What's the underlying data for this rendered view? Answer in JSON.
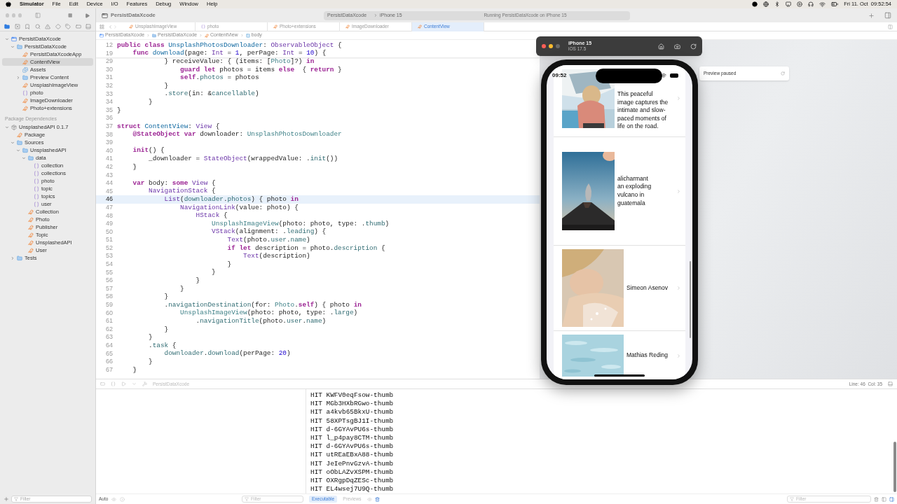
{
  "menubar": {
    "app_name": "Simulator",
    "menus": [
      "File",
      "Edit",
      "Device",
      "I/O",
      "Features",
      "Debug",
      "Window",
      "Help"
    ],
    "clock": "Fri 11. Oct  09:52:54"
  },
  "toolbar": {
    "project": "PersistDataXcode",
    "scheme": "PersistDataXcode",
    "destination": "iPhone 15",
    "status": "Running PersistDataXcode on iPhone 15"
  },
  "tabs": [
    {
      "label": "UnsplashImageView",
      "kind": "swift",
      "selected": false
    },
    {
      "label": "photo",
      "kind": "json",
      "selected": false
    },
    {
      "label": "Photo+extensions",
      "kind": "swift",
      "selected": false
    },
    {
      "label": "ImageDownloader",
      "kind": "swift",
      "selected": false
    },
    {
      "label": "ContentView",
      "kind": "swift",
      "selected": true
    }
  ],
  "jump_bar": [
    {
      "label": "PersistDataXcode",
      "kind": "project"
    },
    {
      "label": "PersistDataXcode",
      "kind": "folder"
    },
    {
      "label": "ContentView",
      "kind": "swift"
    },
    {
      "label": "body",
      "kind": "property"
    }
  ],
  "navigator": {
    "tree": [
      {
        "label": "PersistDataXcode",
        "kind": "project",
        "expanded": true,
        "selected": false,
        "children": [
          {
            "label": "PersistDataXcode",
            "kind": "folder",
            "expanded": true,
            "selected": false,
            "children": [
              {
                "label": "PersistDataXcodeApp",
                "kind": "swift",
                "selected": false
              },
              {
                "label": "ContentView",
                "kind": "swift",
                "selected": true
              },
              {
                "label": "Assets",
                "kind": "assets",
                "selected": false
              },
              {
                "label": "Preview Content",
                "kind": "folder",
                "expanded": false,
                "selected": false
              },
              {
                "label": "UnsplashImageView",
                "kind": "swift",
                "selected": false
              },
              {
                "label": "photo",
                "kind": "json",
                "selected": false
              },
              {
                "label": "ImageDownloader",
                "kind": "swift",
                "selected": false
              },
              {
                "label": "Photo+extensions",
                "kind": "swift",
                "selected": false
              }
            ]
          }
        ]
      }
    ],
    "section_title": "Package Dependencies",
    "packages": [
      {
        "label": "UnsplashedAPI 0.1.7",
        "kind": "package",
        "expanded": true,
        "selected": false,
        "children": [
          {
            "label": "Package",
            "kind": "swift",
            "selected": false
          },
          {
            "label": "Sources",
            "kind": "folder",
            "expanded": true,
            "selected": false,
            "children": [
              {
                "label": "UnsplashedAPI",
                "kind": "folder",
                "expanded": true,
                "selected": false,
                "children": [
                  {
                    "label": "data",
                    "kind": "folder",
                    "expanded": true,
                    "selected": false,
                    "children": [
                      {
                        "label": "collection",
                        "kind": "json",
                        "selected": false
                      },
                      {
                        "label": "collections",
                        "kind": "json",
                        "selected": false
                      },
                      {
                        "label": "photo",
                        "kind": "json",
                        "selected": false
                      },
                      {
                        "label": "topic",
                        "kind": "json",
                        "selected": false
                      },
                      {
                        "label": "topics",
                        "kind": "json",
                        "selected": false
                      },
                      {
                        "label": "user",
                        "kind": "json",
                        "selected": false
                      }
                    ]
                  },
                  {
                    "label": "Collection",
                    "kind": "swift",
                    "selected": false
                  },
                  {
                    "label": "Photo",
                    "kind": "swift",
                    "selected": false
                  },
                  {
                    "label": "Publisher",
                    "kind": "swift",
                    "selected": false
                  },
                  {
                    "label": "Topic",
                    "kind": "swift",
                    "selected": false
                  },
                  {
                    "label": "UnsplashedAPI",
                    "kind": "swift",
                    "selected": false
                  },
                  {
                    "label": "User",
                    "kind": "swift",
                    "selected": false
                  }
                ]
              }
            ]
          },
          {
            "label": "Tests",
            "kind": "folder",
            "expanded": false,
            "selected": false
          }
        ]
      }
    ],
    "filter_placeholder": "Filter"
  },
  "editor": {
    "sticky_lines": [
      {
        "number": "12",
        "segments": [
          {
            "kind": "kw",
            "text": "public class "
          },
          {
            "kind": "decl",
            "text": "UnsplashPhotosDownloader"
          },
          {
            "kind": "plain",
            "text": ": "
          },
          {
            "kind": "type",
            "text": "ObservableObject"
          },
          {
            "kind": "plain",
            "text": " {"
          }
        ]
      },
      {
        "number": "19",
        "segments": [
          {
            "kind": "kw",
            "text": "    func "
          },
          {
            "kind": "decl",
            "text": "download"
          },
          {
            "kind": "plain",
            "text": "(page: "
          },
          {
            "kind": "type",
            "text": "Int"
          },
          {
            "kind": "plain",
            "text": " = "
          },
          {
            "kind": "num",
            "text": "1"
          },
          {
            "kind": "plain",
            "text": ", perPage: "
          },
          {
            "kind": "type",
            "text": "Int"
          },
          {
            "kind": "plain",
            "text": " = "
          },
          {
            "kind": "num",
            "text": "10"
          },
          {
            "kind": "plain",
            "text": ") {"
          }
        ]
      }
    ],
    "lines": [
      {
        "number": "29",
        "current": false,
        "segments": [
          {
            "kind": "plain",
            "text": "            } receiveValue: { (items: ["
          },
          {
            "kind": "ptype",
            "text": "Photo"
          },
          {
            "kind": "plain",
            "text": "]?) "
          },
          {
            "kind": "kw",
            "text": "in"
          }
        ]
      },
      {
        "number": "30",
        "current": false,
        "segments": [
          {
            "kind": "kw",
            "text": "                guard let "
          },
          {
            "kind": "plain",
            "text": "photos = items "
          },
          {
            "kind": "kw",
            "text": "else"
          },
          {
            "kind": "plain",
            "text": "  { "
          },
          {
            "kind": "kw",
            "text": "return"
          },
          {
            "kind": "plain",
            "text": " }"
          }
        ]
      },
      {
        "number": "31",
        "current": false,
        "segments": [
          {
            "kind": "kw",
            "text": "                self"
          },
          {
            "kind": "plain",
            "text": "."
          },
          {
            "kind": "prop",
            "text": "photos"
          },
          {
            "kind": "plain",
            "text": " = photos"
          }
        ]
      },
      {
        "number": "32",
        "current": false,
        "segments": [
          {
            "kind": "plain",
            "text": "            }"
          }
        ]
      },
      {
        "number": "33",
        "current": false,
        "segments": [
          {
            "kind": "plain",
            "text": "            ."
          },
          {
            "kind": "fn",
            "text": "store"
          },
          {
            "kind": "plain",
            "text": "(in: &"
          },
          {
            "kind": "prop",
            "text": "cancellable"
          },
          {
            "kind": "plain",
            "text": ")"
          }
        ]
      },
      {
        "number": "34",
        "current": false,
        "segments": [
          {
            "kind": "plain",
            "text": "        }"
          }
        ]
      },
      {
        "number": "35",
        "current": false,
        "segments": [
          {
            "kind": "plain",
            "text": "}"
          }
        ]
      },
      {
        "number": "36",
        "current": false
      },
      {
        "number": "37",
        "current": false,
        "segments": [
          {
            "kind": "kw",
            "text": "struct "
          },
          {
            "kind": "decl",
            "text": "ContentView"
          },
          {
            "kind": "plain",
            "text": ": "
          },
          {
            "kind": "type",
            "text": "View"
          },
          {
            "kind": "plain",
            "text": " {"
          }
        ]
      },
      {
        "number": "38",
        "current": false,
        "segments": [
          {
            "kind": "kw",
            "text": "    @StateObject var "
          },
          {
            "kind": "plain",
            "text": "downloader: "
          },
          {
            "kind": "ptype",
            "text": "UnsplashPhotosDownloader"
          }
        ]
      },
      {
        "number": "39",
        "current": false
      },
      {
        "number": "40",
        "current": false,
        "segments": [
          {
            "kind": "kw",
            "text": "    init"
          },
          {
            "kind": "plain",
            "text": "() {"
          }
        ]
      },
      {
        "number": "41",
        "current": false,
        "segments": [
          {
            "kind": "plain",
            "text": "        _downloader = "
          },
          {
            "kind": "type",
            "text": "StateObject"
          },
          {
            "kind": "plain",
            "text": "(wrappedValue: ."
          },
          {
            "kind": "fn",
            "text": "init"
          },
          {
            "kind": "plain",
            "text": "())"
          }
        ]
      },
      {
        "number": "42",
        "current": false,
        "segments": [
          {
            "kind": "plain",
            "text": "    }"
          }
        ]
      },
      {
        "number": "43",
        "current": false
      },
      {
        "number": "44",
        "current": false,
        "segments": [
          {
            "kind": "kw",
            "text": "    var "
          },
          {
            "kind": "plain",
            "text": "body: "
          },
          {
            "kind": "kw",
            "text": "some "
          },
          {
            "kind": "type",
            "text": "View"
          },
          {
            "kind": "plain",
            "text": " {"
          }
        ]
      },
      {
        "number": "45",
        "current": false,
        "segments": [
          {
            "kind": "type",
            "text": "        NavigationStack"
          },
          {
            "kind": "plain",
            "text": " {"
          }
        ]
      },
      {
        "number": "46",
        "current": true,
        "segments": [
          {
            "kind": "type",
            "text": "            List"
          },
          {
            "kind": "plain",
            "text": "("
          },
          {
            "kind": "prop",
            "text": "downloader"
          },
          {
            "kind": "plain",
            "text": "."
          },
          {
            "kind": "prop",
            "text": "photos"
          },
          {
            "kind": "plain",
            "text": ") { photo "
          },
          {
            "kind": "kw",
            "text": "in"
          }
        ]
      },
      {
        "number": "47",
        "current": false,
        "segments": [
          {
            "kind": "type",
            "text": "                NavigationLink"
          },
          {
            "kind": "plain",
            "text": "(value: photo) {"
          }
        ]
      },
      {
        "number": "48",
        "current": false,
        "segments": [
          {
            "kind": "type",
            "text": "                    HStack"
          },
          {
            "kind": "plain",
            "text": " {"
          }
        ]
      },
      {
        "number": "49",
        "current": false,
        "segments": [
          {
            "kind": "ptype",
            "text": "                        UnsplashImageView"
          },
          {
            "kind": "plain",
            "text": "(photo: photo, type: ."
          },
          {
            "kind": "prop",
            "text": "thumb"
          },
          {
            "kind": "plain",
            "text": ")"
          }
        ]
      },
      {
        "number": "50",
        "current": false,
        "segments": [
          {
            "kind": "type",
            "text": "                        VStack"
          },
          {
            "kind": "plain",
            "text": "(alignment: ."
          },
          {
            "kind": "fn",
            "text": "leading"
          },
          {
            "kind": "plain",
            "text": ") {"
          }
        ]
      },
      {
        "number": "51",
        "current": false,
        "segments": [
          {
            "kind": "type",
            "text": "                            Text"
          },
          {
            "kind": "plain",
            "text": "(photo."
          },
          {
            "kind": "prop",
            "text": "user"
          },
          {
            "kind": "plain",
            "text": "."
          },
          {
            "kind": "prop",
            "text": "name"
          },
          {
            "kind": "plain",
            "text": ")"
          }
        ]
      },
      {
        "number": "52",
        "current": false,
        "segments": [
          {
            "kind": "kw",
            "text": "                            if let "
          },
          {
            "kind": "plain",
            "text": "description = photo."
          },
          {
            "kind": "prop",
            "text": "description"
          },
          {
            "kind": "plain",
            "text": " {"
          }
        ]
      },
      {
        "number": "53",
        "current": false,
        "segments": [
          {
            "kind": "type",
            "text": "                                Text"
          },
          {
            "kind": "plain",
            "text": "(description)"
          }
        ]
      },
      {
        "number": "54",
        "current": false,
        "segments": [
          {
            "kind": "plain",
            "text": "                            }"
          }
        ]
      },
      {
        "number": "55",
        "current": false,
        "segments": [
          {
            "kind": "plain",
            "text": "                        }"
          }
        ]
      },
      {
        "number": "56",
        "current": false,
        "segments": [
          {
            "kind": "plain",
            "text": "                    }"
          }
        ]
      },
      {
        "number": "57",
        "current": false,
        "segments": [
          {
            "kind": "plain",
            "text": "                }"
          }
        ]
      },
      {
        "number": "58",
        "current": false,
        "segments": [
          {
            "kind": "plain",
            "text": "            }"
          }
        ]
      },
      {
        "number": "59",
        "current": false,
        "segments": [
          {
            "kind": "plain",
            "text": "            ."
          },
          {
            "kind": "fn",
            "text": "navigationDestination"
          },
          {
            "kind": "plain",
            "text": "(for: "
          },
          {
            "kind": "ptype",
            "text": "Photo"
          },
          {
            "kind": "plain",
            "text": "."
          },
          {
            "kind": "kw",
            "text": "self"
          },
          {
            "kind": "plain",
            "text": ") { photo "
          },
          {
            "kind": "kw",
            "text": "in"
          }
        ]
      },
      {
        "number": "60",
        "current": false,
        "segments": [
          {
            "kind": "ptype",
            "text": "                UnsplashImageView"
          },
          {
            "kind": "plain",
            "text": "(photo: photo, type: ."
          },
          {
            "kind": "prop",
            "text": "large"
          },
          {
            "kind": "plain",
            "text": ")"
          }
        ]
      },
      {
        "number": "61",
        "current": false,
        "segments": [
          {
            "kind": "plain",
            "text": "                    ."
          },
          {
            "kind": "fn",
            "text": "navigationTitle"
          },
          {
            "kind": "plain",
            "text": "(photo."
          },
          {
            "kind": "prop",
            "text": "user"
          },
          {
            "kind": "plain",
            "text": "."
          },
          {
            "kind": "prop",
            "text": "name"
          },
          {
            "kind": "plain",
            "text": ")"
          }
        ]
      },
      {
        "number": "62",
        "current": false,
        "segments": [
          {
            "kind": "plain",
            "text": "            }"
          }
        ]
      },
      {
        "number": "63",
        "current": false,
        "segments": [
          {
            "kind": "plain",
            "text": "        }"
          }
        ]
      },
      {
        "number": "64",
        "current": false,
        "segments": [
          {
            "kind": "plain",
            "text": "        ."
          },
          {
            "kind": "fn",
            "text": "task"
          },
          {
            "kind": "plain",
            "text": " {"
          }
        ]
      },
      {
        "number": "65",
        "current": false,
        "segments": [
          {
            "kind": "prop",
            "text": "            downloader"
          },
          {
            "kind": "plain",
            "text": "."
          },
          {
            "kind": "fn",
            "text": "download"
          },
          {
            "kind": "plain",
            "text": "(perPage: "
          },
          {
            "kind": "num",
            "text": "20"
          },
          {
            "kind": "plain",
            "text": ")"
          }
        ]
      },
      {
        "number": "66",
        "current": false,
        "segments": [
          {
            "kind": "plain",
            "text": "        }"
          }
        ]
      },
      {
        "number": "67",
        "current": false,
        "segments": [
          {
            "kind": "plain",
            "text": "    }"
          }
        ]
      }
    ]
  },
  "preview": {
    "status": "Preview paused"
  },
  "debug_bar": {
    "target": "PersistDataXcode",
    "position": "Line: 46  Col: 35"
  },
  "variables": {
    "scope": "Auto",
    "filter_placeholder": "Filter"
  },
  "console": {
    "lines": [
      "HIT KWFV0eqFsow-thumb",
      "HIT MGb3HXbRGwo-thumb",
      "HIT a4kvb65BkxU-thumb",
      "HIT 58XPTsgBJ1I-thumb",
      "HIT d-6GYAvPU6s-thumb",
      "HIT l_p4pay8CTM-thumb",
      "HIT d-6GYAvPU6s-thumb",
      "HIT utREaEBxA88-thumb",
      "HIT JeIePnvGzvA-thumb",
      "HIT oObLAZvXSPM-thumb",
      "HIT OXRgpDqZESc-thumb",
      "HIT EL4wsej7U9Q-thumb"
    ],
    "tabs": [
      {
        "label": "Executable",
        "selected": true
      },
      {
        "label": "Previews",
        "selected": false
      }
    ],
    "filter_placeholder": "Filter"
  },
  "simulator": {
    "device": "iPhone 15",
    "os": "iOS 17.5",
    "time": "09:52",
    "rows": [
      {
        "description": "This peaceful image captures the intimate and slow-paced moments of life on the road."
      },
      {
        "name": "alicharmant",
        "description": "an exploding vulcano in guatemala"
      },
      {
        "name": "Simeon Asenov"
      },
      {
        "name": "Mathias Reding"
      }
    ]
  }
}
